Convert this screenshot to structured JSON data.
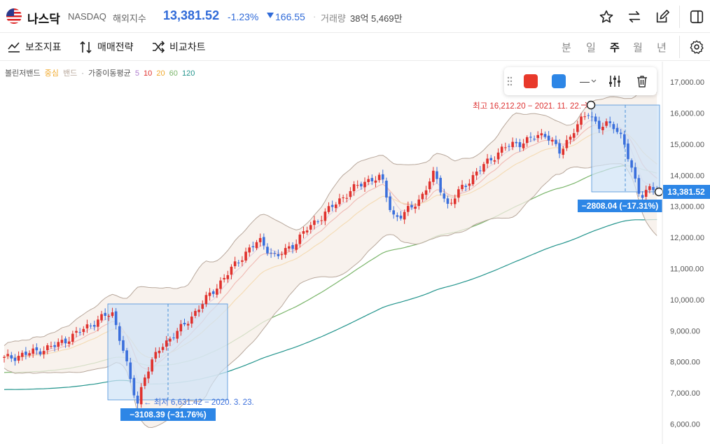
{
  "header": {
    "name": "나스닥",
    "code": "NASDAQ",
    "category": "해외지수",
    "price": "13,381.52",
    "change_rate": "-1.23%",
    "change_value": "166.55",
    "separator": "·",
    "volume_label": "거래량",
    "volume_value": "38억 5,469만"
  },
  "toolbar": {
    "indicators": "보조지표",
    "strategy": "매매전략",
    "compare": "비교차트",
    "periods": [
      "분",
      "일",
      "주",
      "월",
      "년"
    ],
    "active_period": "주"
  },
  "legend": {
    "bb_label": "볼린저밴드",
    "bb_center": "중심",
    "bb_band": "밴드",
    "dot": "·",
    "ma_label": "가중이동평균",
    "ma_5": "5",
    "ma_10": "10",
    "ma_20": "20",
    "ma_60": "60",
    "ma_120": "120"
  },
  "colors": {
    "up": "#e0312d",
    "down": "#3a6fdc",
    "ma5": "#b07fd0",
    "ma10": "#e0312d",
    "ma20": "#f0a92b",
    "ma60": "#7ab56a",
    "ma120": "#22948c",
    "bb": "#b8a89c",
    "range": "#cfe3f7",
    "label_bg": "#2d86e6"
  },
  "drawing_toolbar": {
    "color1": "#e8392b",
    "color2": "#2d86e6",
    "line_style": "—"
  },
  "chart_data": {
    "type": "candlestick",
    "y_ticks": [
      "17,000.00",
      "16,000.00",
      "15,000.00",
      "14,000.00",
      "13,000.00",
      "12,000.00",
      "11,000.00",
      "10,000.00",
      "9,000.00",
      "8,000.00",
      "7,000.00",
      "6,000.00"
    ],
    "ylim": [
      5600,
      17400
    ],
    "current_price_label": "13,381.52",
    "high_annotation": "최고 16,212.20 − 2021. 11. 22.",
    "low_annotation": "← 최저 6,631.42 − 2020. 3. 23.",
    "range_1_label": "−3108.39 (−31.76%)",
    "range_2_label": "−2808.04 (−17.31%)"
  }
}
